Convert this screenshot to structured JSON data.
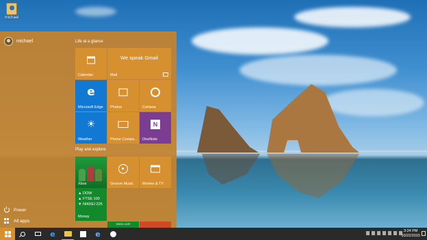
{
  "desktop": {
    "icon_label": "michael"
  },
  "start_menu": {
    "user_name": "michael",
    "power_label": "Power",
    "all_apps_label": "All apps",
    "group1_title": "Life at a glance",
    "group2_title": "Play and explore",
    "tiles": {
      "calendar": "Calendar",
      "mail": "Mail",
      "mail_banner": "We speak Gmail",
      "edge": "Microsoft Edge",
      "photos": "Photos",
      "cortana": "Cortana",
      "weather": "Weather",
      "phone": "Phone Compa...",
      "onenote": "OneNote",
      "xbox": "Xbox",
      "groove": "Groove Music",
      "movies": "Movies & TV",
      "money": "Money",
      "money_lines": [
        "▲ DOW",
        "▲ FTSE 100",
        "▼ NIKKEI 225"
      ],
      "xbox_live": "XBOX LIVE"
    }
  },
  "taskbar": {
    "time": "3:24 PM",
    "date": "10/22/2015"
  },
  "colors": {
    "accent": "#d7902f",
    "edge_blue": "#1179d4",
    "onenote_purple": "#7a3d91",
    "xbox_green": "#128a2c"
  }
}
